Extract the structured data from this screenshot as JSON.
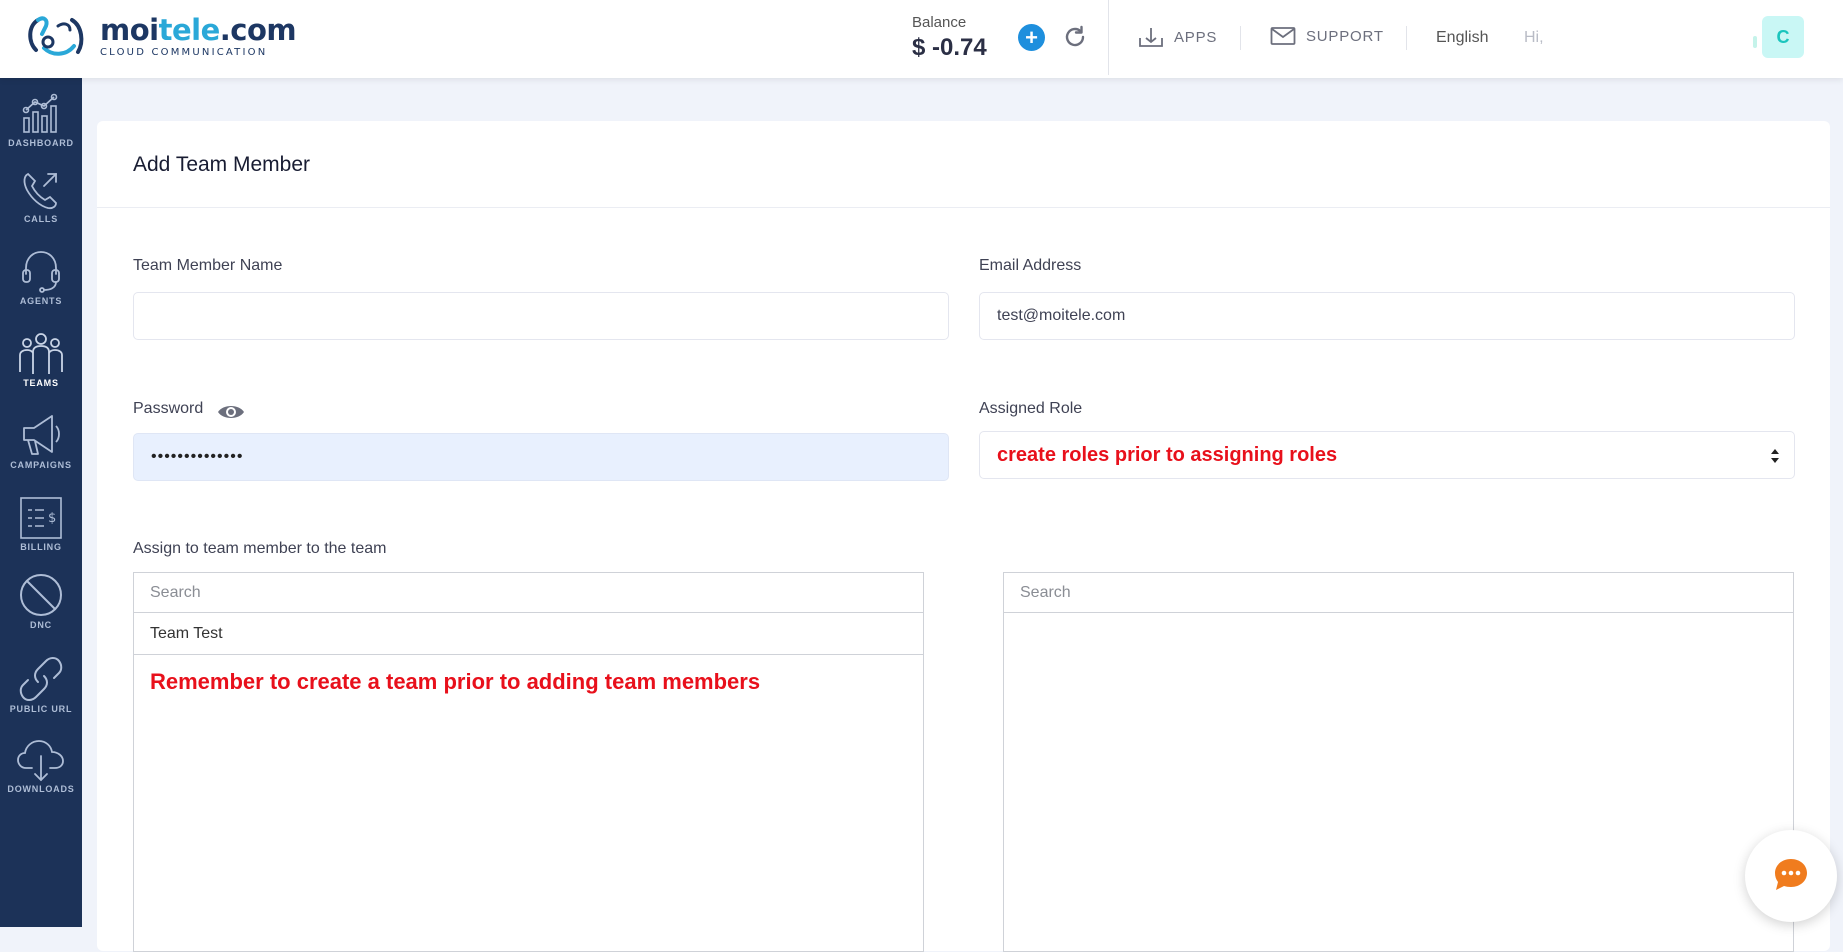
{
  "header": {
    "logo_name_a": "moi",
    "logo_name_b": "tele",
    "logo_name_c": ".com",
    "logo_tagline": "CLOUD COMMUNICATION",
    "balance_label": "Balance",
    "balance_value": "$ -0.74",
    "apps_label": "APPS",
    "support_label": "SUPPORT",
    "language": "English",
    "greeting": "Hi,",
    "avatar_initial": "C"
  },
  "sidebar": {
    "items": [
      {
        "label": "DASHBOARD"
      },
      {
        "label": "CALLS"
      },
      {
        "label": "AGENTS"
      },
      {
        "label": "TEAMS"
      },
      {
        "label": "CAMPAIGNS"
      },
      {
        "label": "BILLING"
      },
      {
        "label": "DNC"
      },
      {
        "label": "PUBLIC URL"
      },
      {
        "label": "DOWNLOADS"
      }
    ],
    "active": "TEAMS"
  },
  "form": {
    "title": "Add Team Member",
    "name_label": "Team Member Name",
    "name_value": "",
    "email_label": "Email Address",
    "email_value": "test@moitele.com",
    "password_label": "Password",
    "password_value": "••••••••••••••",
    "role_label": "Assigned Role",
    "role_value": "create roles prior to assigning roles",
    "assign_label": "Assign to team member to the team",
    "available": {
      "search_placeholder": "Search",
      "options": [
        "Team Test"
      ],
      "note": "Remember to create a team prior to adding team members"
    },
    "selected": {
      "search_placeholder": "Search",
      "options": []
    }
  },
  "colors": {
    "sidebar_bg": "#1c3258",
    "accent_blue": "#1e8fdd",
    "annotation_red": "#e8101b",
    "avatar_bg": "#c9f7f5"
  }
}
